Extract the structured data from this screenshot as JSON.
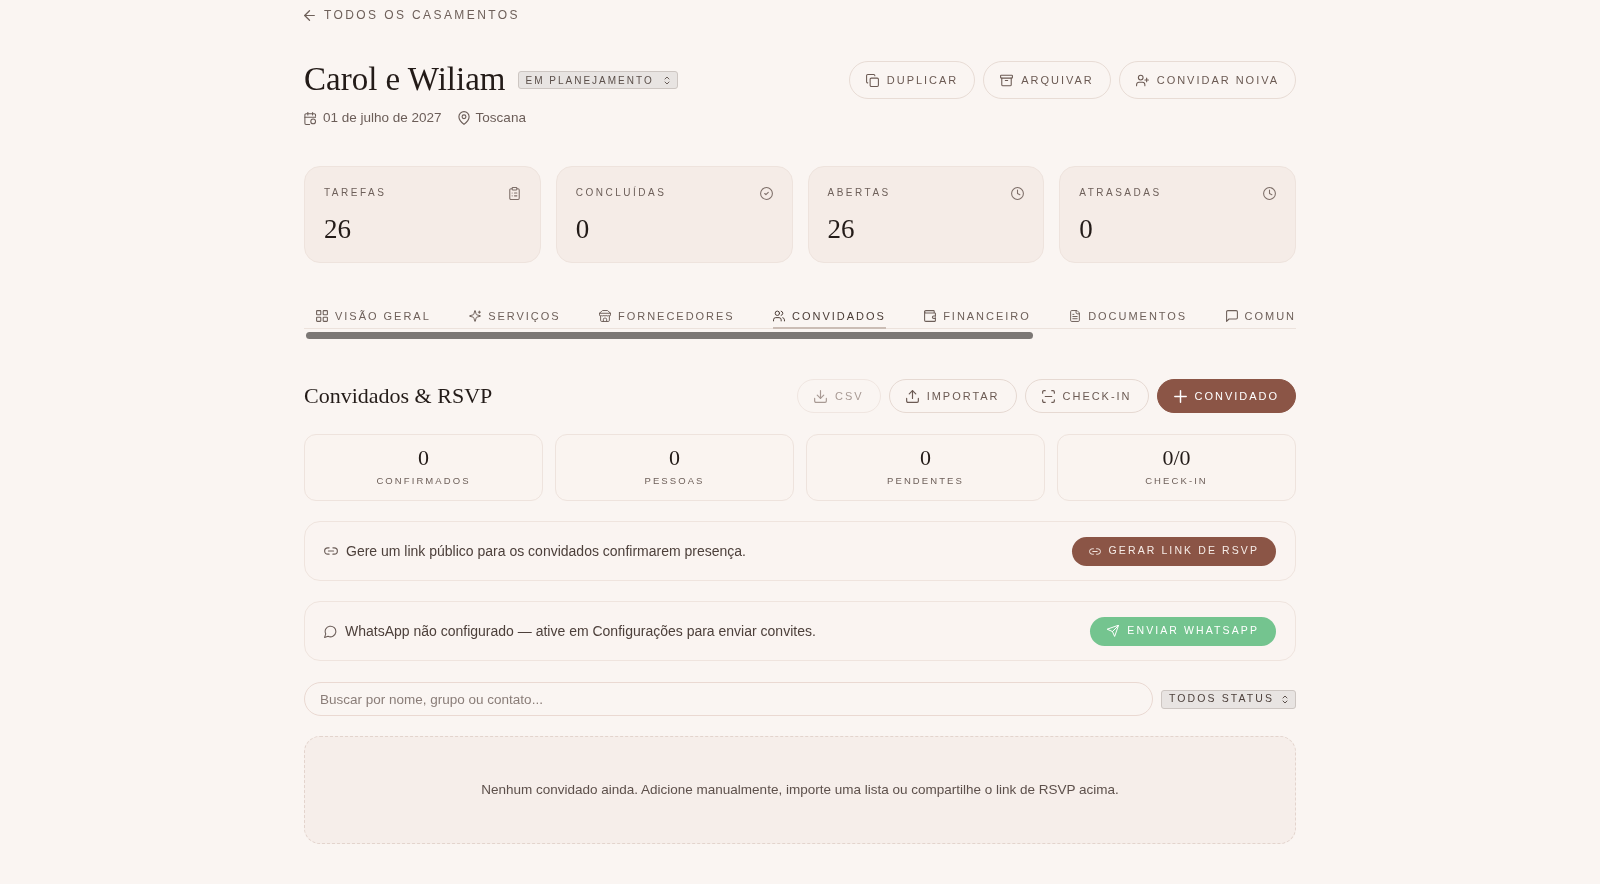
{
  "back_link": {
    "label": "TODOS OS CASAMENTOS"
  },
  "header": {
    "title": "Carol e Wiliam",
    "status": "EM PLANEJAMENTO",
    "date": "01 de julho de 2027",
    "location": "Toscana",
    "actions": [
      {
        "label": "DUPLICAR"
      },
      {
        "label": "ARQUIVAR"
      },
      {
        "label": "CONVIDAR NOIVA"
      }
    ]
  },
  "stats": [
    {
      "label": "TAREFAS",
      "value": "26"
    },
    {
      "label": "CONCLUÍDAS",
      "value": "0"
    },
    {
      "label": "ABERTAS",
      "value": "26"
    },
    {
      "label": "ATRASADAS",
      "value": "0"
    }
  ],
  "tabs": [
    {
      "label": "VISÃO GERAL",
      "selected": false
    },
    {
      "label": "SERVIÇOS",
      "selected": false
    },
    {
      "label": "FORNECEDORES",
      "selected": false
    },
    {
      "label": "CONVIDADOS",
      "selected": true
    },
    {
      "label": "FINANCEIRO",
      "selected": false
    },
    {
      "label": "DOCUMENTOS",
      "selected": false
    },
    {
      "label": "COMUN",
      "selected": false
    }
  ],
  "section": {
    "title": "Convidados & RSVP",
    "actions": [
      {
        "label": "CSV",
        "kind": "outline",
        "disabled": true
      },
      {
        "label": "IMPORTAR",
        "kind": "outline",
        "disabled": false
      },
      {
        "label": "CHECK-IN",
        "kind": "outline",
        "disabled": false
      },
      {
        "label": "CONVIDADO",
        "kind": "primary",
        "disabled": false
      }
    ]
  },
  "summary": [
    {
      "value": "0",
      "label": "CONFIRMADOS"
    },
    {
      "value": "0",
      "label": "PESSOAS"
    },
    {
      "value": "0",
      "label": "PENDENTES"
    },
    {
      "value": "0/0",
      "label": "CHECK-IN"
    }
  ],
  "banners": [
    {
      "kind": "link",
      "text": "Gere um link público para os convidados confirmarem presença.",
      "button": {
        "label": "GERAR LINK DE RSVP",
        "disabled": false
      }
    },
    {
      "kind": "whatsapp",
      "text": "WhatsApp não configurado — ative em Configurações para enviar convites.",
      "button": {
        "label": "ENVIAR WHATSAPP",
        "disabled": true
      }
    }
  ],
  "search": {
    "placeholder": "Buscar por nome, grupo ou contato..."
  },
  "status_filter": {
    "value": "TODOS STATUS"
  },
  "empty_state": {
    "text": "Nenhum convidado ainda. Adicione manualmente, importe uma lista ou compartilhe o link de RSVP acima."
  }
}
